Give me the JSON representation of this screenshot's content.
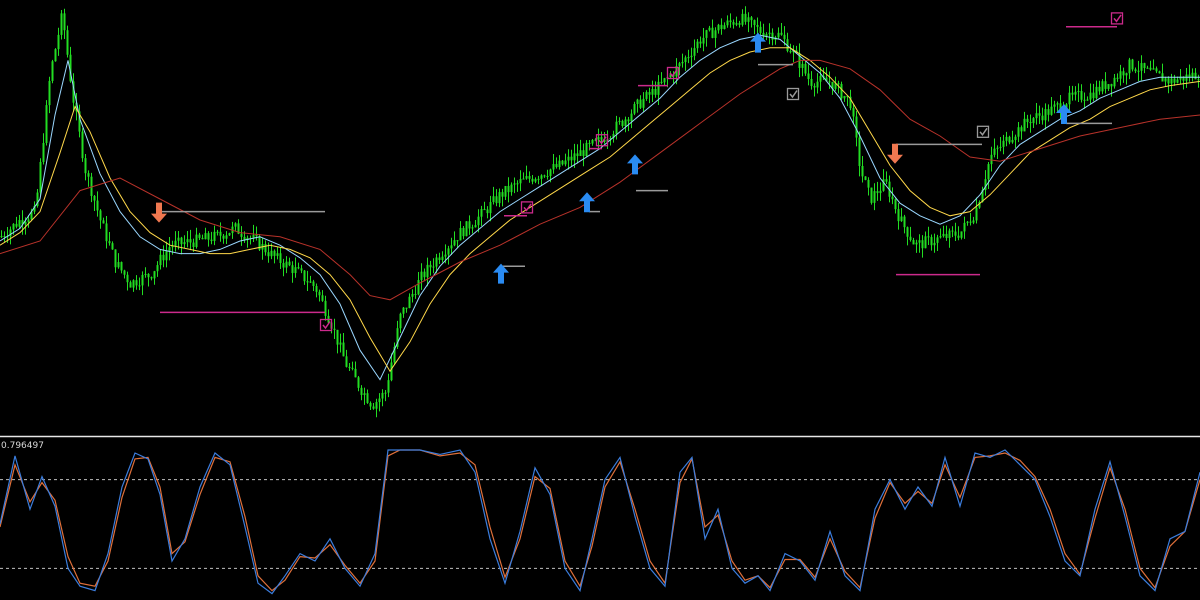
{
  "colors": {
    "background": "#000000",
    "candle_up": "#22dd22",
    "candle_down": "#22dd22",
    "ma_fast": "#9ad7ff",
    "ma_mid": "#ffd84a",
    "ma_slow": "#b8322a",
    "separator": "#e8e8e8",
    "level_line": "#bfbfbf",
    "stoch_main": "#3b7ddd",
    "stoch_signal": "#e0703a",
    "arrow_buy": "#2a8bf2",
    "arrow_sell": "#f07850",
    "check_target": "#cc2a8c",
    "check_stop": "#9a9a9a",
    "target_line": "#cc2a8c",
    "stop_line": "#9a9a9a"
  },
  "chart_data": [
    {
      "type": "line",
      "panel": "price",
      "title": "",
      "xlabel": "",
      "ylabel": "",
      "grid": false,
      "x_range": [
        0,
        1200
      ],
      "ylim": [
        0,
        100
      ],
      "series": [
        {
          "x": [
            0,
            20,
            35,
            50,
            62,
            72,
            85,
            100,
            115,
            130,
            150,
            170,
            195,
            215,
            235,
            255,
            275,
            295,
            315,
            330,
            345,
            360,
            372,
            385,
            400,
            420,
            440,
            460,
            480,
            500,
            520,
            540,
            560,
            580,
            600,
            620,
            640,
            660,
            680,
            700,
            720,
            740,
            760,
            780,
            795,
            810,
            830,
            850,
            860,
            870,
            885,
            900,
            915,
            930,
            945,
            960,
            975,
            990,
            1010,
            1030,
            1050,
            1070,
            1090,
            1110,
            1130,
            1150,
            1170,
            1200
          ],
          "values": [
            46,
            50,
            52,
            85,
            99,
            80,
            62,
            50,
            40,
            35,
            37,
            44,
            45,
            46,
            48,
            45,
            41,
            38,
            34,
            26,
            16,
            10,
            6,
            9,
            27,
            36,
            42,
            47,
            51,
            56,
            59,
            61,
            63,
            66,
            69,
            73,
            78,
            82,
            87,
            93,
            96,
            98,
            95,
            94,
            89,
            83,
            83,
            78,
            62,
            55,
            59,
            50,
            44,
            45,
            46,
            47,
            52,
            65,
            70,
            74,
            76,
            79,
            80,
            83,
            87,
            85,
            83,
            85
          ]
        },
        {
          "x": [
            0,
            20,
            40,
            55,
            68,
            80,
            100,
            120,
            140,
            160,
            180,
            200,
            220,
            240,
            260,
            280,
            300,
            320,
            340,
            360,
            380,
            400,
            420,
            440,
            460,
            480,
            500,
            520,
            540,
            560,
            580,
            600,
            620,
            640,
            660,
            680,
            700,
            720,
            740,
            760,
            780,
            800,
            820,
            840,
            860,
            880,
            900,
            920,
            940,
            960,
            980,
            1000,
            1020,
            1040,
            1060,
            1080,
            1100,
            1120,
            1140,
            1160,
            1180,
            1200
          ],
          "values": [
            45,
            48,
            55,
            75,
            88,
            74,
            61,
            52,
            46,
            43,
            42,
            42,
            43,
            45,
            46,
            44,
            41,
            37,
            30,
            19,
            12,
            22,
            32,
            39,
            44,
            48,
            52,
            55,
            58,
            61,
            64,
            67,
            71,
            75,
            79,
            84,
            88,
            91,
            93,
            94,
            93,
            89,
            85,
            79,
            70,
            60,
            54,
            51,
            49,
            51,
            56,
            63,
            68,
            71,
            74,
            76,
            79,
            81,
            83,
            84,
            84,
            84
          ]
        },
        {
          "x": [
            0,
            20,
            40,
            60,
            75,
            90,
            110,
            130,
            150,
            170,
            190,
            210,
            230,
            250,
            270,
            290,
            310,
            330,
            350,
            370,
            390,
            410,
            430,
            450,
            470,
            490,
            510,
            530,
            550,
            570,
            590,
            610,
            630,
            650,
            670,
            690,
            710,
            730,
            750,
            770,
            790,
            810,
            830,
            850,
            870,
            890,
            910,
            930,
            950,
            970,
            990,
            1010,
            1030,
            1050,
            1070,
            1090,
            1110,
            1130,
            1150,
            1170,
            1200
          ],
          "values": [
            44,
            47,
            52,
            66,
            77,
            71,
            60,
            52,
            47,
            44,
            43,
            42,
            42,
            43,
            44,
            43,
            41,
            37,
            31,
            22,
            14,
            21,
            30,
            37,
            42,
            46,
            50,
            53,
            56,
            59,
            62,
            65,
            69,
            73,
            77,
            81,
            85,
            88,
            90,
            91,
            91,
            88,
            84,
            79,
            71,
            63,
            57,
            53,
            51,
            52,
            56,
            61,
            66,
            69,
            72,
            74,
            77,
            79,
            81,
            82,
            83
          ]
        },
        {
          "x": [
            0,
            40,
            80,
            120,
            160,
            200,
            240,
            280,
            320,
            350,
            370,
            390,
            420,
            460,
            500,
            540,
            580,
            620,
            660,
            700,
            740,
            780,
            800,
            820,
            850,
            880,
            910,
            940,
            970,
            1000,
            1040,
            1080,
            1120,
            1160,
            1200
          ],
          "values": [
            42,
            45,
            57,
            60,
            55,
            50,
            47,
            46,
            43,
            37,
            32,
            31,
            35,
            40,
            44,
            49,
            53,
            59,
            66,
            73,
            80,
            86,
            88,
            88,
            86,
            81,
            74,
            70,
            65,
            64,
            67,
            70,
            72,
            74,
            75
          ]
        }
      ]
    },
    {
      "type": "line",
      "panel": "stochastic",
      "title": "",
      "xlabel": "",
      "ylabel": "",
      "grid": false,
      "ylim": [
        0,
        100
      ],
      "top_label": "0.796497",
      "levels": [
        80,
        20
      ],
      "x": [
        0,
        15,
        30,
        42,
        55,
        68,
        80,
        95,
        108,
        122,
        135,
        148,
        160,
        172,
        185,
        200,
        215,
        230,
        245,
        258,
        272,
        285,
        300,
        315,
        330,
        345,
        360,
        375,
        388,
        400,
        420,
        440,
        460,
        475,
        490,
        505,
        520,
        535,
        550,
        565,
        580,
        592,
        605,
        620,
        635,
        650,
        665,
        680,
        692,
        705,
        718,
        732,
        745,
        758,
        770,
        785,
        800,
        815,
        830,
        845,
        860,
        875,
        890,
        905,
        918,
        932,
        945,
        960,
        975,
        990,
        1005,
        1020,
        1035,
        1050,
        1065,
        1080,
        1095,
        1110,
        1125,
        1140,
        1155,
        1170,
        1185,
        1200
      ],
      "series": [
        {
          "values": [
            50,
            96,
            60,
            82,
            62,
            20,
            8,
            5,
            30,
            75,
            98,
            94,
            70,
            25,
            40,
            75,
            98,
            90,
            48,
            10,
            3,
            15,
            30,
            25,
            40,
            20,
            8,
            30,
            100,
            100,
            100,
            97,
            100,
            85,
            40,
            10,
            45,
            88,
            70,
            20,
            5,
            40,
            80,
            95,
            55,
            20,
            8,
            85,
            95,
            40,
            60,
            20,
            10,
            15,
            5,
            30,
            25,
            12,
            45,
            15,
            5,
            60,
            80,
            60,
            75,
            62,
            95,
            62,
            98,
            95,
            100,
            90,
            80,
            55,
            25,
            15,
            60,
            92,
            55,
            15,
            5,
            40,
            45,
            85
          ]
        },
        {
          "values": [
            48,
            90,
            65,
            78,
            66,
            28,
            10,
            8,
            25,
            68,
            94,
            95,
            75,
            30,
            38,
            70,
            95,
            92,
            55,
            15,
            5,
            12,
            28,
            27,
            36,
            22,
            10,
            25,
            96,
            100,
            100,
            96,
            98,
            90,
            48,
            14,
            40,
            82,
            74,
            25,
            8,
            35,
            75,
            92,
            60,
            25,
            10,
            78,
            94,
            48,
            56,
            25,
            12,
            15,
            7,
            26,
            26,
            14,
            40,
            18,
            7,
            54,
            78,
            64,
            72,
            64,
            90,
            68,
            95,
            96,
            98,
            93,
            82,
            60,
            30,
            16,
            54,
            88,
            60,
            20,
            7,
            35,
            45,
            80
          ]
        }
      ]
    }
  ],
  "signals": {
    "buy_arrows": [
      {
        "x": 501,
        "price": 37
      },
      {
        "x": 587,
        "price": 54
      },
      {
        "x": 635,
        "price": 63
      },
      {
        "x": 758,
        "price": 92
      },
      {
        "x": 1064,
        "price": 75
      }
    ],
    "sell_arrows": [
      {
        "x": 159,
        "price": 52
      },
      {
        "x": 895,
        "price": 66
      }
    ],
    "target_checks": [
      {
        "x": 326,
        "price": 25
      },
      {
        "x": 527,
        "price": 53
      },
      {
        "x": 602,
        "price": 69
      },
      {
        "x": 673,
        "price": 85
      },
      {
        "x": 1117,
        "price": 98
      }
    ],
    "stop_checks": [
      {
        "x": 793,
        "price": 80
      },
      {
        "x": 983,
        "price": 71
      }
    ],
    "target_lines": [
      {
        "x1": 160,
        "x2": 325,
        "price": 28
      },
      {
        "x1": 504,
        "x2": 527,
        "price": 51
      },
      {
        "x1": 589,
        "x2": 602,
        "price": 67
      },
      {
        "x1": 638,
        "x2": 668,
        "price": 82
      },
      {
        "x1": 896,
        "x2": 980,
        "price": 37
      },
      {
        "x1": 1066,
        "x2": 1117,
        "price": 96
      }
    ],
    "stop_lines": [
      {
        "x1": 162,
        "x2": 325,
        "price": 52
      },
      {
        "x1": 503,
        "x2": 525,
        "price": 39
      },
      {
        "x1": 589,
        "x2": 600,
        "price": 52
      },
      {
        "x1": 636,
        "x2": 668,
        "price": 57
      },
      {
        "x1": 758,
        "x2": 793,
        "price": 87
      },
      {
        "x1": 896,
        "x2": 982,
        "price": 68
      },
      {
        "x1": 1066,
        "x2": 1112,
        "price": 73
      }
    ]
  }
}
